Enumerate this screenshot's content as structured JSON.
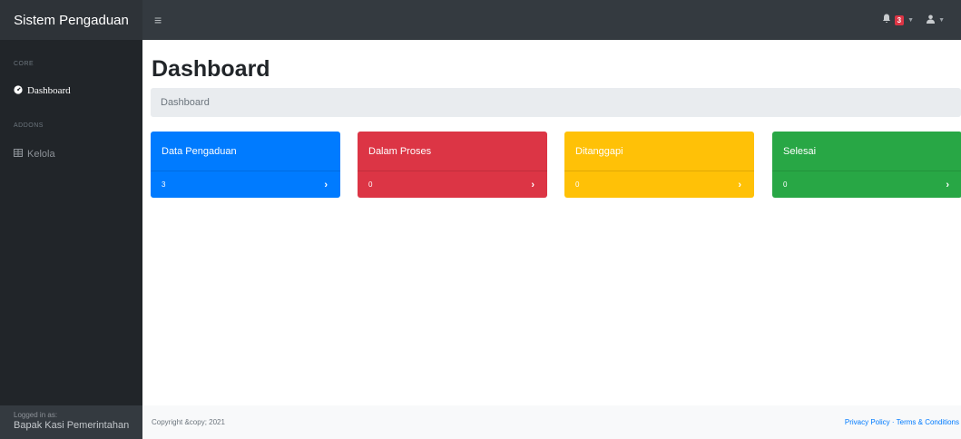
{
  "app": {
    "brand": "Sistem Pengaduan"
  },
  "topnav": {
    "notification_count": "3",
    "toggle_glyph": "≡",
    "bell_glyph": "🔔",
    "user_glyph": "👤",
    "caret_glyph": "▼",
    "toggle_icon": "hamburger-icon",
    "bell_icon": "bell-icon",
    "user_icon": "user-icon"
  },
  "sidebar": {
    "core_heading": "CORE",
    "dashboard_label": "Dashboard",
    "addons_heading": "ADDONS",
    "kelola_label": "Kelola",
    "footer_small": "Logged in as:",
    "footer_user": "Bapak Kasi Pemerintahan"
  },
  "main": {
    "title": "Dashboard",
    "breadcrumb": "Dashboard"
  },
  "cards": [
    {
      "title": "Data Pengaduan",
      "count": "3",
      "color": "#007bff"
    },
    {
      "title": "Dalam Proses",
      "count": "0",
      "color": "#dc3545"
    },
    {
      "title": "Ditanggapi",
      "count": "0",
      "color": "#ffc107"
    },
    {
      "title": "Selesai",
      "count": "0",
      "color": "#28a745"
    }
  ],
  "card_chevron": "›",
  "footer": {
    "copyright": "Copyright &copy; 2021",
    "privacy": "Privacy Policy",
    "separator": " · ",
    "terms": "Terms & Conditions"
  },
  "colors": {
    "navbar": "#343a40",
    "sidebar": "#212529",
    "link": "#007bff"
  }
}
